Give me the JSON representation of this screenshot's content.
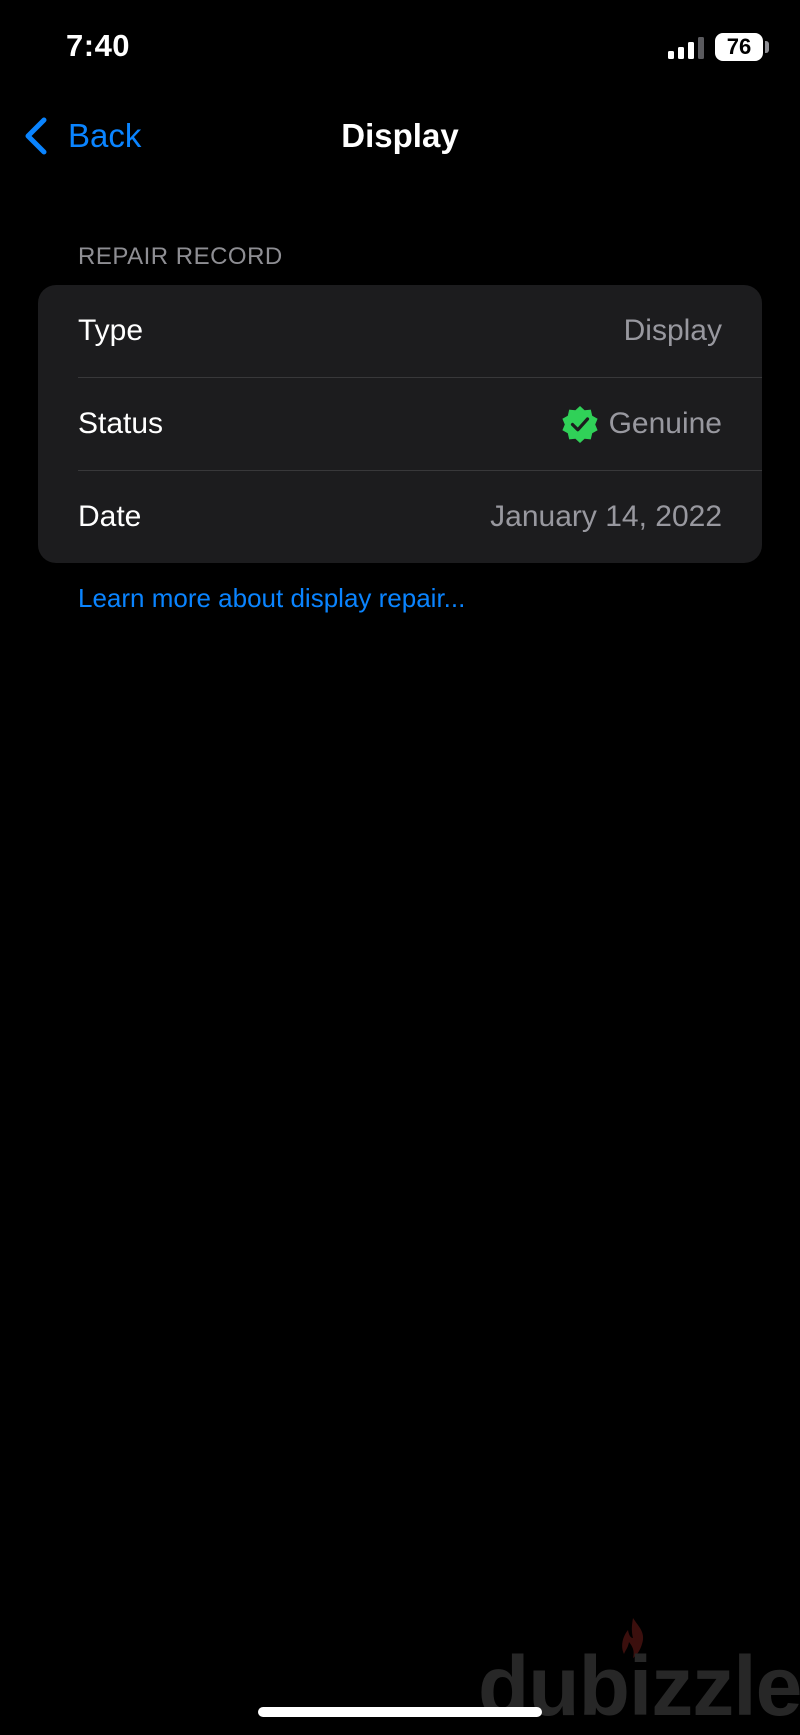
{
  "status_bar": {
    "time": "7:40",
    "battery_level": "76",
    "signal_icon": "cellular-signal-icon",
    "battery_icon": "battery-icon"
  },
  "nav": {
    "back_label": "Back",
    "back_icon": "chevron-left-icon",
    "title": "Display"
  },
  "section": {
    "header": "REPAIR RECORD",
    "rows": [
      {
        "label": "Type",
        "value": "Display"
      },
      {
        "label": "Status",
        "value": "Genuine",
        "icon": "verified-check-icon"
      },
      {
        "label": "Date",
        "value": "January 14, 2022"
      }
    ],
    "footer_link": "Learn more about display repair..."
  },
  "watermark": {
    "text": "dubizzle"
  },
  "colors": {
    "background": "#000000",
    "card": "#1c1c1e",
    "accent_blue": "#0a84ff",
    "secondary_text": "#98989f",
    "verified_green": "#30d158"
  }
}
